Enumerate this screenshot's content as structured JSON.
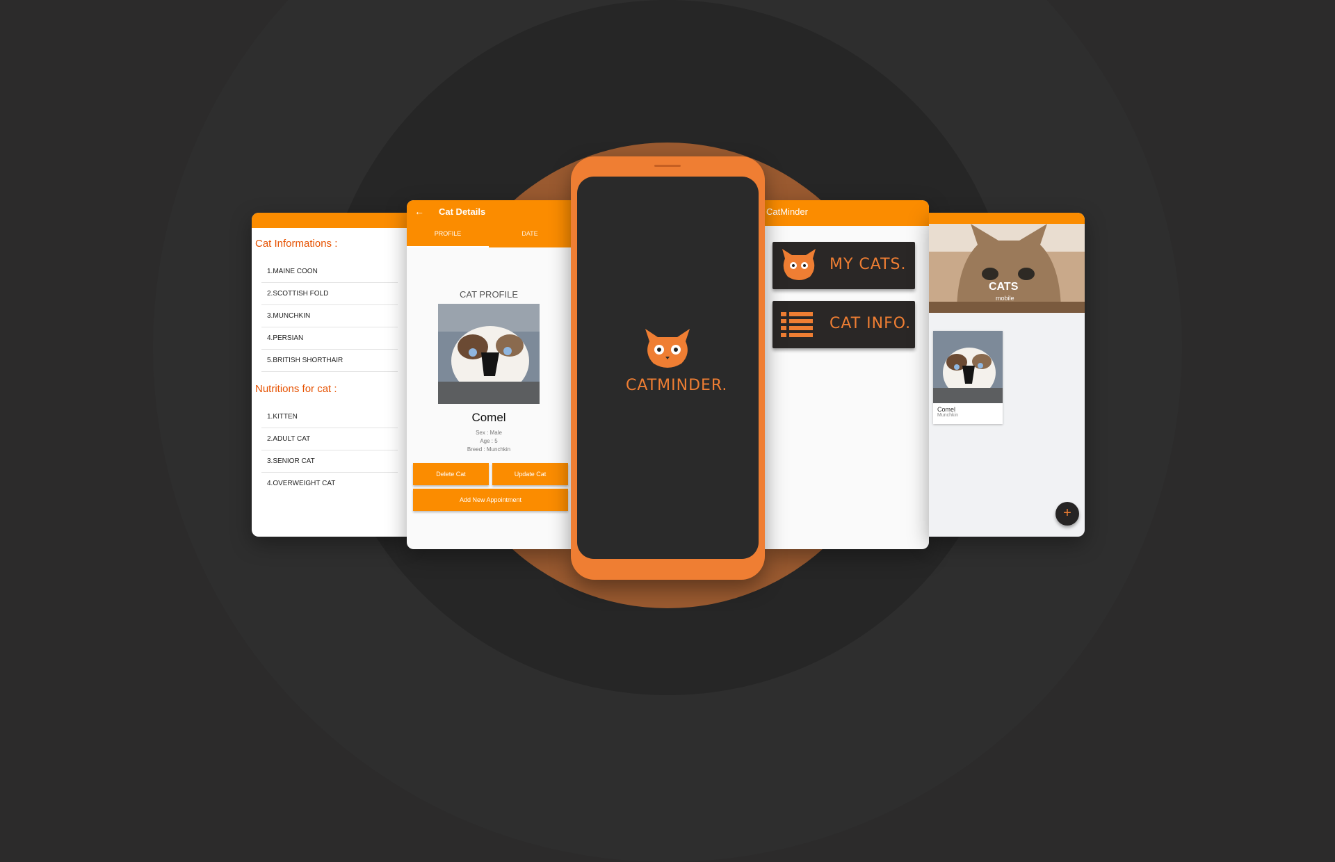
{
  "screen_info": {
    "heading_breeds": "Cat Informations :",
    "breeds": [
      "1.MAINE COON",
      "2.SCOTTISH FOLD",
      "3.MUNCHKIN",
      "4.PERSIAN",
      "5.BRITISH SHORTHAIR"
    ],
    "heading_nutrition": "Nutritions for cat :",
    "nutrition": [
      "1.KITTEN",
      "2.ADULT CAT",
      "3.SENIOR CAT",
      "4.OVERWEIGHT CAT"
    ]
  },
  "screen_details": {
    "back_icon": "arrow-back-icon",
    "title": "Cat Details",
    "tabs": [
      "PROFILE",
      "DATE"
    ],
    "profile_title": "CAT PROFILE",
    "name": "Comel",
    "sex": "Sex : Male",
    "age": "Age : 5",
    "breed": "Breed : Munchkin",
    "delete_label": "Delete Cat",
    "update_label": "Update Cat",
    "appointment_label": "Add New Appointment"
  },
  "splash": {
    "logo_text": "CATMINDER."
  },
  "screen_menu": {
    "title": "CatMinder",
    "item_cats": "MY CATS.",
    "item_info": "CAT INFO."
  },
  "screen_list": {
    "hero_title": "CATS",
    "hero_subtitle": "mobile",
    "card_name": "Comel",
    "card_breed": "Munchkin",
    "fab_label": "+"
  },
  "colors": {
    "accent": "#fb8c00",
    "brand": "#ef7e33",
    "dark": "#2a2a2a",
    "background": "#2c2b2b"
  }
}
